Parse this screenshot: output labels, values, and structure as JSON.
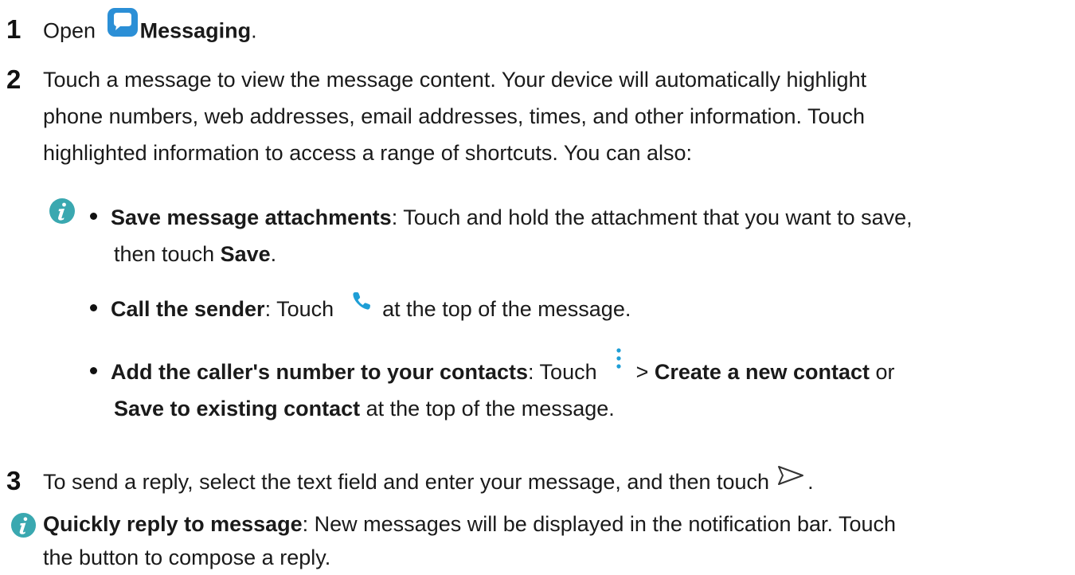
{
  "steps": [
    {
      "number": "1",
      "open": "Open",
      "app_name": "Messaging",
      "period": "."
    },
    {
      "number": "2",
      "lines": [
        "Touch a message to view the message content. Your device will automatically highlight",
        "phone numbers, web addresses, email addresses, times, and other information. Touch",
        "highlighted information to access a range of shortcuts. You can also:"
      ]
    },
    {
      "number": "3",
      "text_before": "To send a reply, select the text field and enter your message, and then touch",
      "text_after": "."
    }
  ],
  "tips": [
    {
      "title": "Save message attachments",
      "text1": ": Touch and hold the attachment that you want to save,",
      "text2": "then touch ",
      "bold2": "Save",
      "end2": "."
    },
    {
      "title": "Call the sender",
      "text_before": ": Touch ",
      "text_after": " at the top of the message."
    },
    {
      "title": "Add the caller's number to your contacts",
      "text_before": ": Touch ",
      "gt": " > ",
      "bold1": "Create a new contact",
      "or": " or",
      "bold2": "Save to existing contact",
      "end": " at the top of the message."
    }
  ],
  "note": {
    "title": "Quickly reply to message",
    "text1": ": New messages will be displayed in the notification bar. Touch",
    "text2": "the button to compose a reply."
  },
  "colors": {
    "messaging_icon": "#2b8fd6",
    "info_icon": "#3aa8b0",
    "phone_icon": "#1e9ed6",
    "more_icon": "#1e9ed6"
  }
}
